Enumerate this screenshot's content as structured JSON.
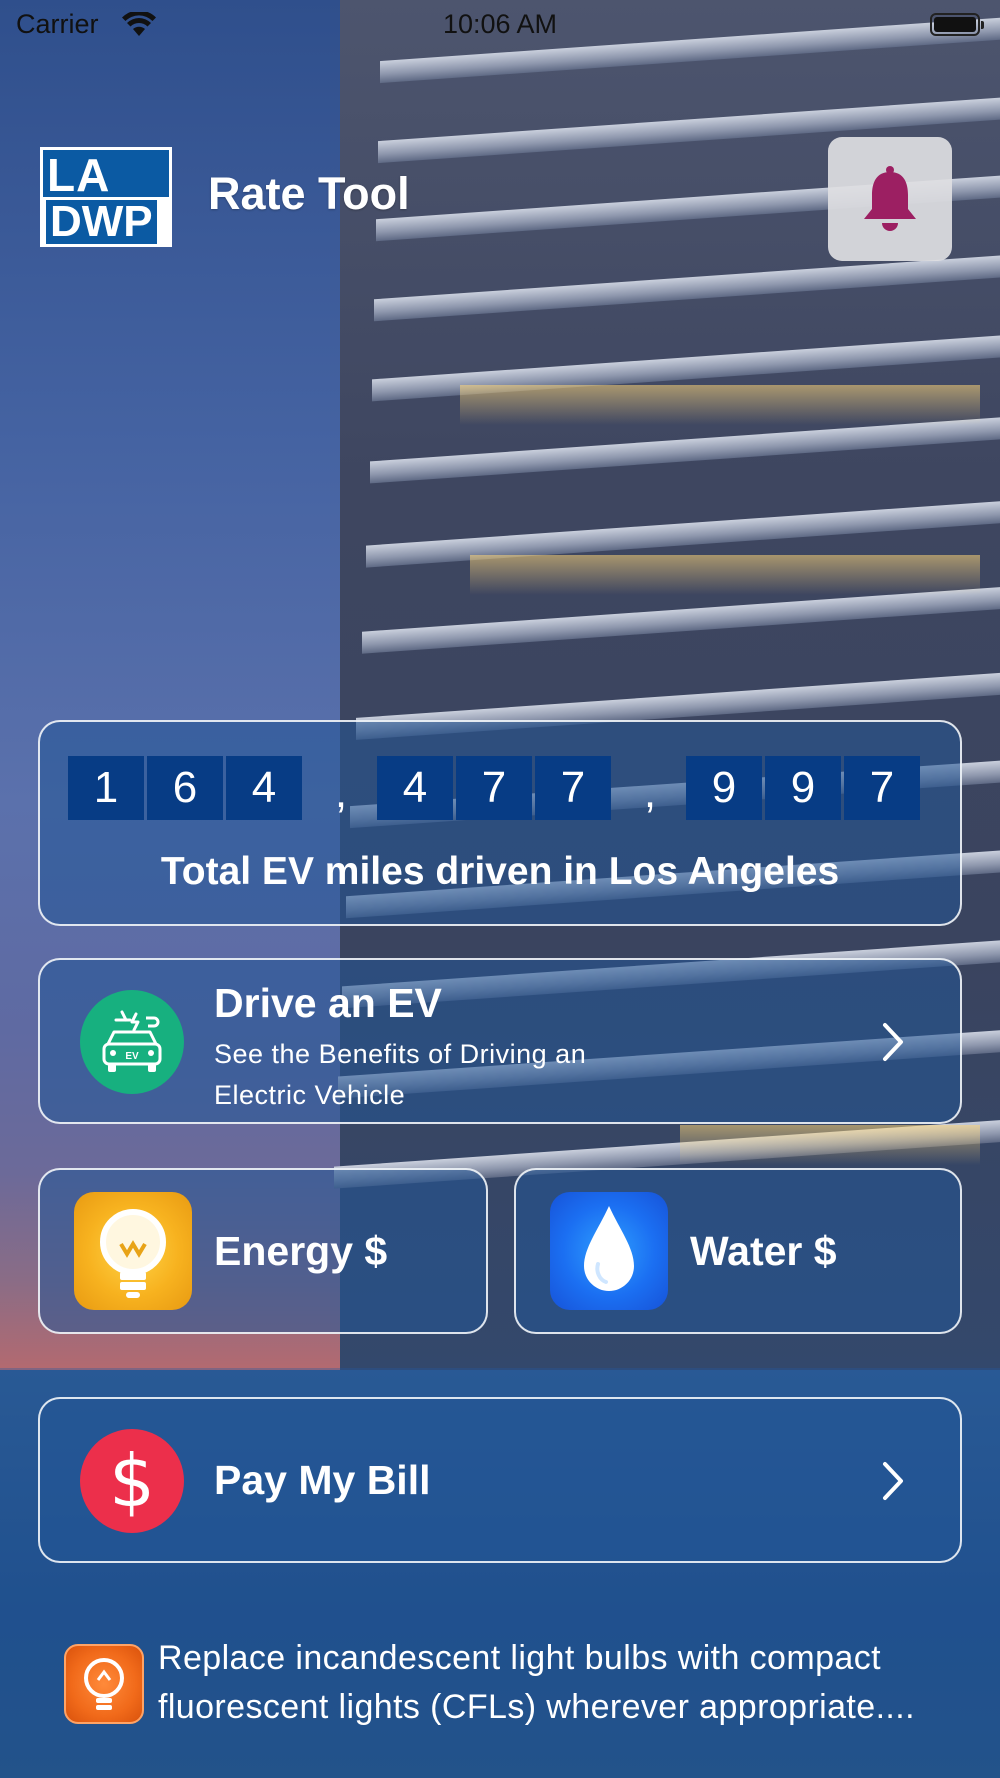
{
  "status_bar": {
    "carrier": "Carrier",
    "time": "10:06 AM"
  },
  "header": {
    "logo_line1": "LA",
    "logo_line2": "DWP",
    "title": "Rate Tool",
    "notification_icon": "bell-icon",
    "notification_color": "#9c1f62"
  },
  "ev_counter": {
    "groups": [
      [
        "1",
        "6",
        "4"
      ],
      [
        "4",
        "7",
        "7"
      ],
      [
        "9",
        "9",
        "7"
      ]
    ],
    "separator": ",",
    "caption": "Total EV miles driven in Los Angeles"
  },
  "drive_ev": {
    "icon": "ev-car-icon",
    "icon_badge": "EV",
    "icon_color": "#17b07f",
    "title": "Drive an EV",
    "subtitle": "See the Benefits of Driving an Electric Vehicle"
  },
  "energy": {
    "icon": "lightbulb-icon",
    "label": "Energy $"
  },
  "water": {
    "icon": "water-drop-icon",
    "label": "Water $"
  },
  "pay_bill": {
    "icon": "dollar-icon",
    "icon_glyph": "$",
    "icon_color": "#ec2f4b",
    "label": "Pay My Bill"
  },
  "tip": {
    "icon": "tip-lightbulb-icon",
    "line1": "Replace incandescent light bulbs with compact",
    "line2": "fluorescent lights (CFLs) wherever appropriate...."
  }
}
